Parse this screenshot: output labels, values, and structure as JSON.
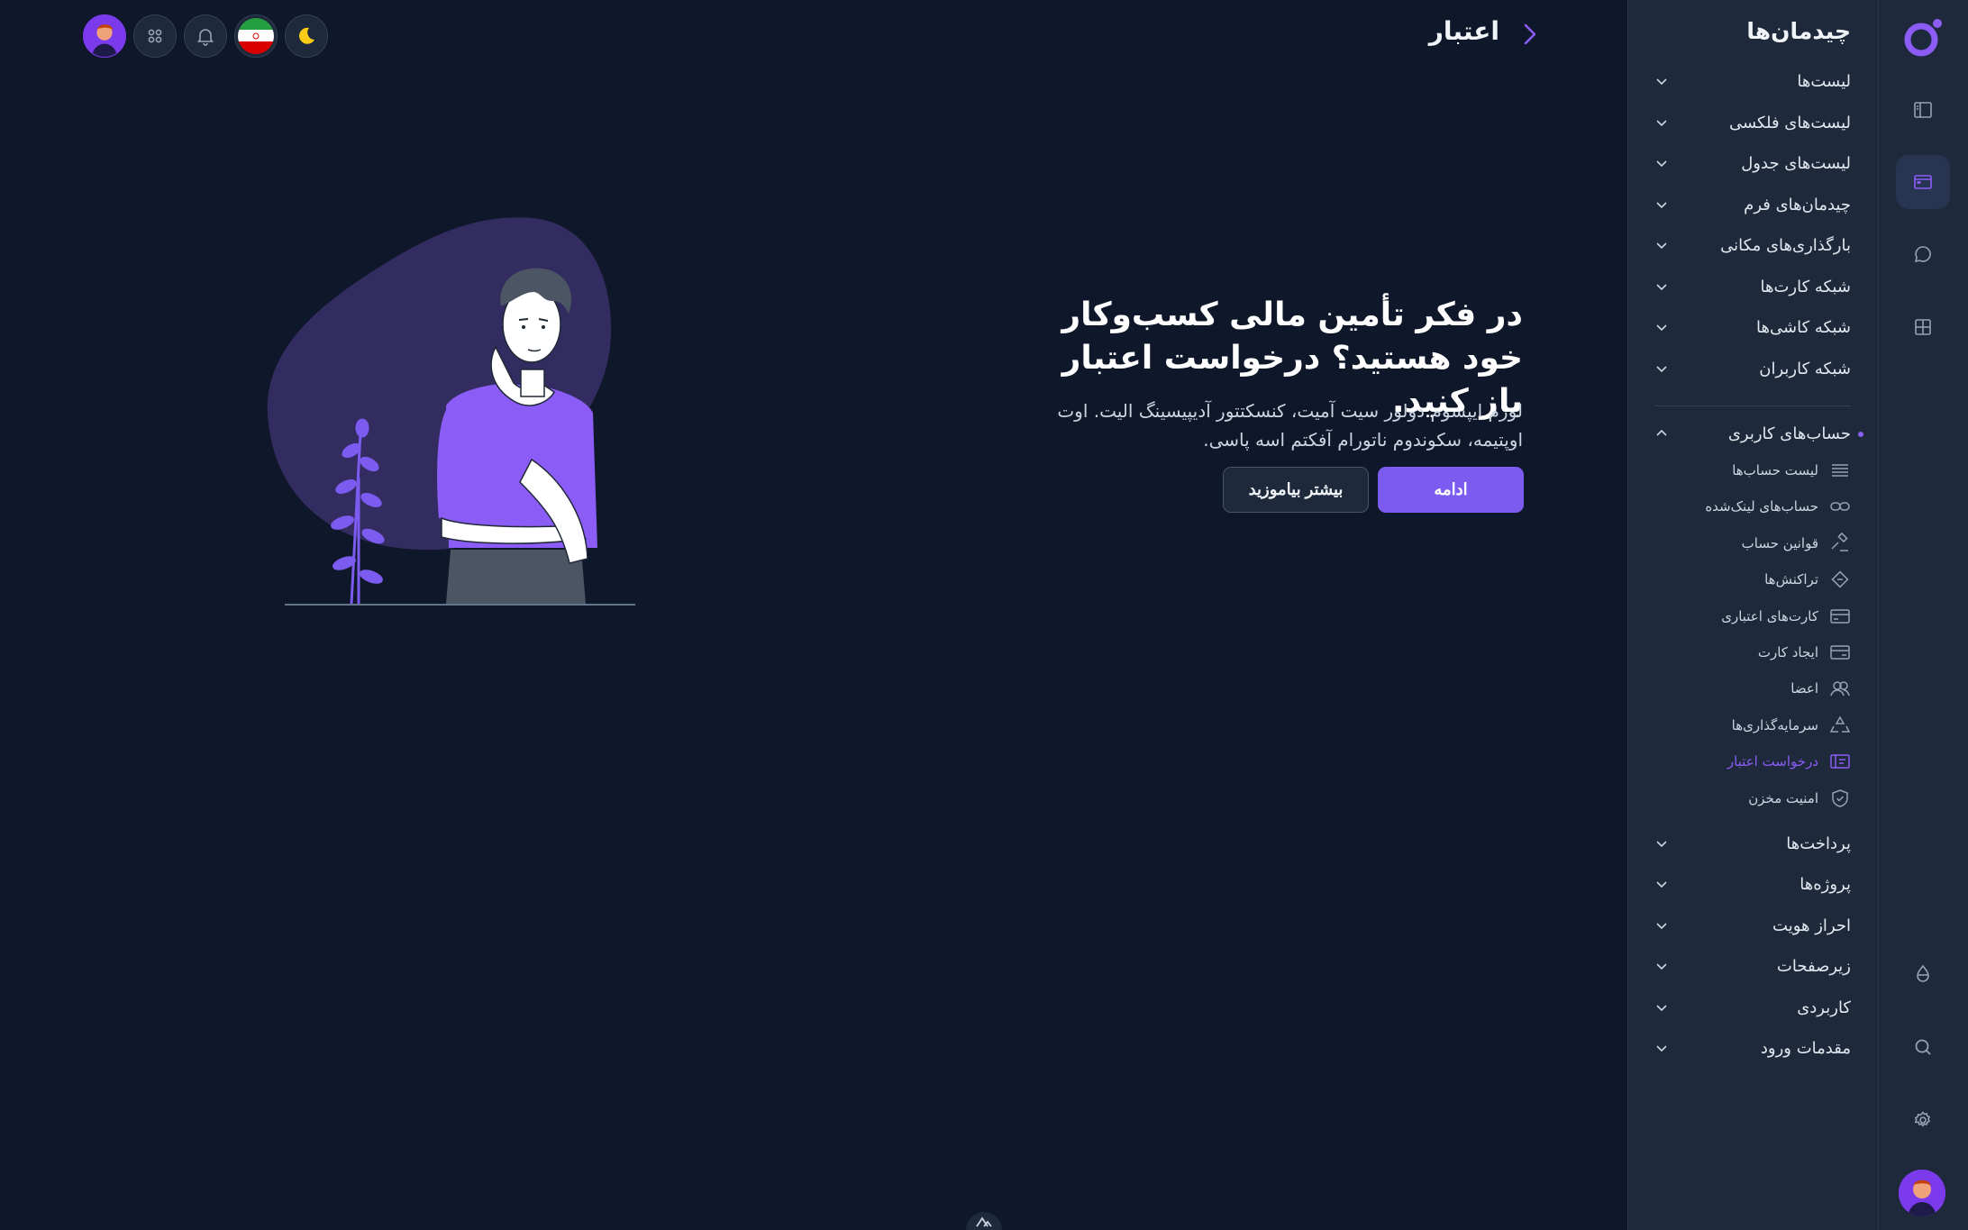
{
  "header": {
    "title": "اعتبار"
  },
  "hero": {
    "title": "در فکر تأمین مالی کسب‌وکار خود هستید؟ درخواست اعتبار باز کنید.",
    "text": "لورم ایپسوم دولور سیت آمیت، کنسکتتور آدیپیسینگ الیت. اوت اوپتیمه، سکوندوم ناتورام آفکتم اسه پاسی.",
    "primary_button": "ادامه",
    "secondary_button": "بیشتر بیاموزید"
  },
  "sidebar": {
    "title": "چیدمان‌ها",
    "menu_top": [
      "لیست‌ها",
      "لیست‌های فلکسی",
      "لیست‌های جدول",
      "چیدمان‌های فرم",
      "بارگذاری‌های مکانی",
      "شبکه کارت‌ها",
      "شبکه کاشی‌ها",
      "شبکه کاربران"
    ],
    "expanded": {
      "label": "حساب‌های کاربری",
      "items": [
        {
          "label": "لیست حساب‌ها",
          "icon": "list-icon"
        },
        {
          "label": "حساب‌های لینک‌شده",
          "icon": "link-icon"
        },
        {
          "label": "قوانین حساب",
          "icon": "gavel-icon"
        },
        {
          "label": "تراکنش‌ها",
          "icon": "transactions-icon"
        },
        {
          "label": "کارت‌های اعتباری",
          "icon": "credit-card-icon"
        },
        {
          "label": "ایجاد کارت",
          "icon": "card-create-icon"
        },
        {
          "label": "اعضا",
          "icon": "members-icon"
        },
        {
          "label": "سرمایه‌گذاری‌ها",
          "icon": "recycle-icon"
        },
        {
          "label": "درخواست اعتبار",
          "icon": "credit-request-icon",
          "active": true
        },
        {
          "label": "امنیت مخزن",
          "icon": "shield-icon"
        }
      ]
    },
    "menu_bottom": [
      "پرداخت‌ها",
      "پروژه‌ها",
      "احراز هویت",
      "زیرصفحات",
      "کاربردی",
      "مقدمات ورود"
    ]
  },
  "colors": {
    "background": "#0f172a",
    "panel": "#1e293b",
    "accent": "#7c5cf0"
  }
}
